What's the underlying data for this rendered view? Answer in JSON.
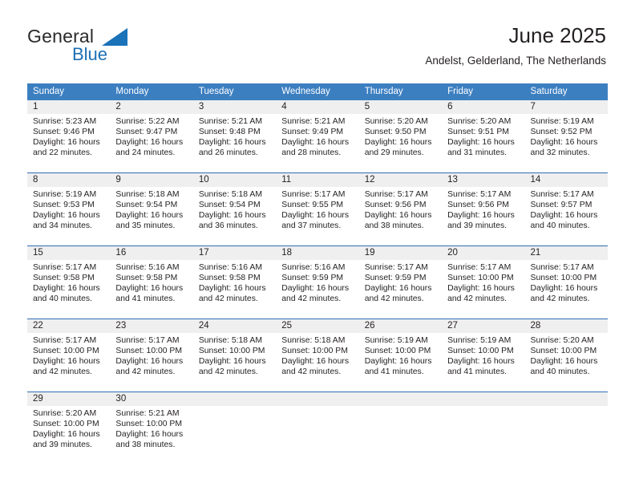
{
  "logo": {
    "text_top": "General",
    "text_bottom": "Blue",
    "triangle_color": "#1a72b8",
    "blue_color": "#1c6fb5"
  },
  "header": {
    "title": "June 2025",
    "subtitle": "Andelst, Gelderland, The Netherlands"
  },
  "theme": {
    "header_row_bg": "#3c7fc1",
    "header_row_text": "#ffffff",
    "row_divider": "#2f6eb5",
    "daynum_band_bg": "#efefef",
    "body_text": "#231f20"
  },
  "weekdays": [
    "Sunday",
    "Monday",
    "Tuesday",
    "Wednesday",
    "Thursday",
    "Friday",
    "Saturday"
  ],
  "weeks": [
    [
      {
        "day": "1",
        "sunrise": "Sunrise: 5:23 AM",
        "sunset": "Sunset: 9:46 PM",
        "daylight1": "Daylight: 16 hours",
        "daylight2": "and 22 minutes."
      },
      {
        "day": "2",
        "sunrise": "Sunrise: 5:22 AM",
        "sunset": "Sunset: 9:47 PM",
        "daylight1": "Daylight: 16 hours",
        "daylight2": "and 24 minutes."
      },
      {
        "day": "3",
        "sunrise": "Sunrise: 5:21 AM",
        "sunset": "Sunset: 9:48 PM",
        "daylight1": "Daylight: 16 hours",
        "daylight2": "and 26 minutes."
      },
      {
        "day": "4",
        "sunrise": "Sunrise: 5:21 AM",
        "sunset": "Sunset: 9:49 PM",
        "daylight1": "Daylight: 16 hours",
        "daylight2": "and 28 minutes."
      },
      {
        "day": "5",
        "sunrise": "Sunrise: 5:20 AM",
        "sunset": "Sunset: 9:50 PM",
        "daylight1": "Daylight: 16 hours",
        "daylight2": "and 29 minutes."
      },
      {
        "day": "6",
        "sunrise": "Sunrise: 5:20 AM",
        "sunset": "Sunset: 9:51 PM",
        "daylight1": "Daylight: 16 hours",
        "daylight2": "and 31 minutes."
      },
      {
        "day": "7",
        "sunrise": "Sunrise: 5:19 AM",
        "sunset": "Sunset: 9:52 PM",
        "daylight1": "Daylight: 16 hours",
        "daylight2": "and 32 minutes."
      }
    ],
    [
      {
        "day": "8",
        "sunrise": "Sunrise: 5:19 AM",
        "sunset": "Sunset: 9:53 PM",
        "daylight1": "Daylight: 16 hours",
        "daylight2": "and 34 minutes."
      },
      {
        "day": "9",
        "sunrise": "Sunrise: 5:18 AM",
        "sunset": "Sunset: 9:54 PM",
        "daylight1": "Daylight: 16 hours",
        "daylight2": "and 35 minutes."
      },
      {
        "day": "10",
        "sunrise": "Sunrise: 5:18 AM",
        "sunset": "Sunset: 9:54 PM",
        "daylight1": "Daylight: 16 hours",
        "daylight2": "and 36 minutes."
      },
      {
        "day": "11",
        "sunrise": "Sunrise: 5:17 AM",
        "sunset": "Sunset: 9:55 PM",
        "daylight1": "Daylight: 16 hours",
        "daylight2": "and 37 minutes."
      },
      {
        "day": "12",
        "sunrise": "Sunrise: 5:17 AM",
        "sunset": "Sunset: 9:56 PM",
        "daylight1": "Daylight: 16 hours",
        "daylight2": "and 38 minutes."
      },
      {
        "day": "13",
        "sunrise": "Sunrise: 5:17 AM",
        "sunset": "Sunset: 9:56 PM",
        "daylight1": "Daylight: 16 hours",
        "daylight2": "and 39 minutes."
      },
      {
        "day": "14",
        "sunrise": "Sunrise: 5:17 AM",
        "sunset": "Sunset: 9:57 PM",
        "daylight1": "Daylight: 16 hours",
        "daylight2": "and 40 minutes."
      }
    ],
    [
      {
        "day": "15",
        "sunrise": "Sunrise: 5:17 AM",
        "sunset": "Sunset: 9:58 PM",
        "daylight1": "Daylight: 16 hours",
        "daylight2": "and 40 minutes."
      },
      {
        "day": "16",
        "sunrise": "Sunrise: 5:16 AM",
        "sunset": "Sunset: 9:58 PM",
        "daylight1": "Daylight: 16 hours",
        "daylight2": "and 41 minutes."
      },
      {
        "day": "17",
        "sunrise": "Sunrise: 5:16 AM",
        "sunset": "Sunset: 9:58 PM",
        "daylight1": "Daylight: 16 hours",
        "daylight2": "and 42 minutes."
      },
      {
        "day": "18",
        "sunrise": "Sunrise: 5:16 AM",
        "sunset": "Sunset: 9:59 PM",
        "daylight1": "Daylight: 16 hours",
        "daylight2": "and 42 minutes."
      },
      {
        "day": "19",
        "sunrise": "Sunrise: 5:17 AM",
        "sunset": "Sunset: 9:59 PM",
        "daylight1": "Daylight: 16 hours",
        "daylight2": "and 42 minutes."
      },
      {
        "day": "20",
        "sunrise": "Sunrise: 5:17 AM",
        "sunset": "Sunset: 10:00 PM",
        "daylight1": "Daylight: 16 hours",
        "daylight2": "and 42 minutes."
      },
      {
        "day": "21",
        "sunrise": "Sunrise: 5:17 AM",
        "sunset": "Sunset: 10:00 PM",
        "daylight1": "Daylight: 16 hours",
        "daylight2": "and 42 minutes."
      }
    ],
    [
      {
        "day": "22",
        "sunrise": "Sunrise: 5:17 AM",
        "sunset": "Sunset: 10:00 PM",
        "daylight1": "Daylight: 16 hours",
        "daylight2": "and 42 minutes."
      },
      {
        "day": "23",
        "sunrise": "Sunrise: 5:17 AM",
        "sunset": "Sunset: 10:00 PM",
        "daylight1": "Daylight: 16 hours",
        "daylight2": "and 42 minutes."
      },
      {
        "day": "24",
        "sunrise": "Sunrise: 5:18 AM",
        "sunset": "Sunset: 10:00 PM",
        "daylight1": "Daylight: 16 hours",
        "daylight2": "and 42 minutes."
      },
      {
        "day": "25",
        "sunrise": "Sunrise: 5:18 AM",
        "sunset": "Sunset: 10:00 PM",
        "daylight1": "Daylight: 16 hours",
        "daylight2": "and 42 minutes."
      },
      {
        "day": "26",
        "sunrise": "Sunrise: 5:19 AM",
        "sunset": "Sunset: 10:00 PM",
        "daylight1": "Daylight: 16 hours",
        "daylight2": "and 41 minutes."
      },
      {
        "day": "27",
        "sunrise": "Sunrise: 5:19 AM",
        "sunset": "Sunset: 10:00 PM",
        "daylight1": "Daylight: 16 hours",
        "daylight2": "and 41 minutes."
      },
      {
        "day": "28",
        "sunrise": "Sunrise: 5:20 AM",
        "sunset": "Sunset: 10:00 PM",
        "daylight1": "Daylight: 16 hours",
        "daylight2": "and 40 minutes."
      }
    ],
    [
      {
        "day": "29",
        "sunrise": "Sunrise: 5:20 AM",
        "sunset": "Sunset: 10:00 PM",
        "daylight1": "Daylight: 16 hours",
        "daylight2": "and 39 minutes."
      },
      {
        "day": "30",
        "sunrise": "Sunrise: 5:21 AM",
        "sunset": "Sunset: 10:00 PM",
        "daylight1": "Daylight: 16 hours",
        "daylight2": "and 38 minutes."
      },
      {
        "day": "",
        "sunrise": "",
        "sunset": "",
        "daylight1": "",
        "daylight2": ""
      },
      {
        "day": "",
        "sunrise": "",
        "sunset": "",
        "daylight1": "",
        "daylight2": ""
      },
      {
        "day": "",
        "sunrise": "",
        "sunset": "",
        "daylight1": "",
        "daylight2": ""
      },
      {
        "day": "",
        "sunrise": "",
        "sunset": "",
        "daylight1": "",
        "daylight2": ""
      },
      {
        "day": "",
        "sunrise": "",
        "sunset": "",
        "daylight1": "",
        "daylight2": ""
      }
    ]
  ]
}
